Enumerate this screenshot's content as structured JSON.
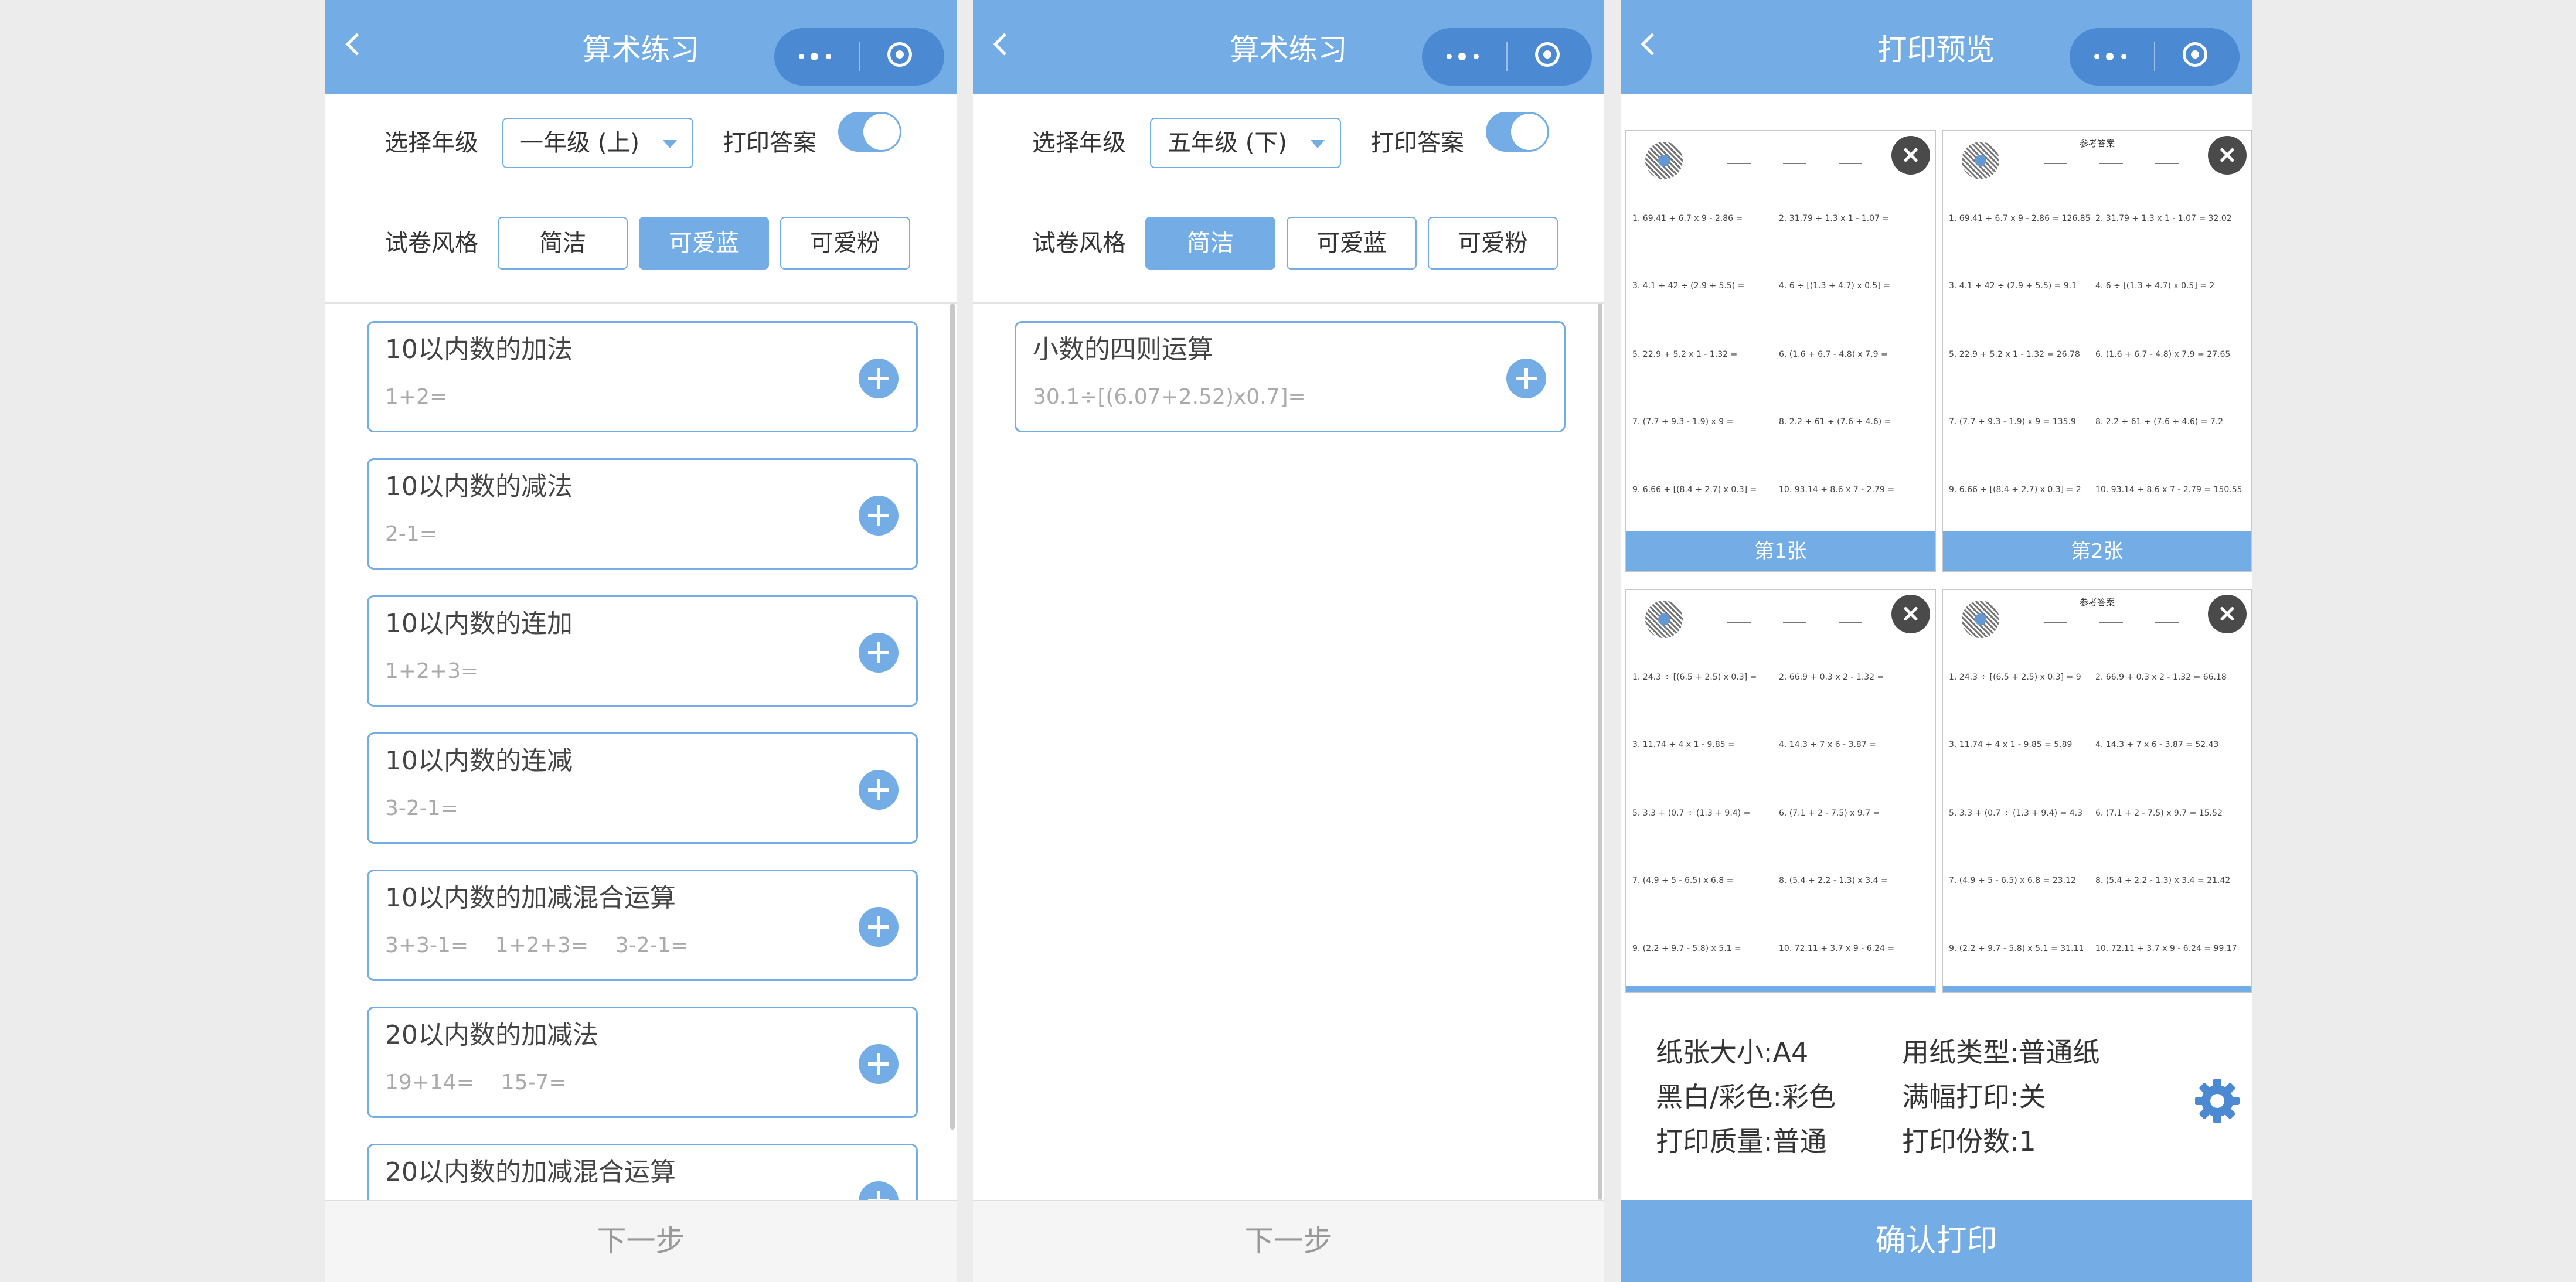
{
  "screen1": {
    "title": "算术练习",
    "grade_label": "选择年级",
    "grade_value": "一年级 (上)",
    "print_answer_label": "打印答案",
    "style_label": "试卷风格",
    "styles": [
      "简洁",
      "可爱蓝",
      "可爱粉"
    ],
    "active_style": "可爱蓝",
    "items": [
      {
        "title": "10以内数的加法",
        "example": "1+2="
      },
      {
        "title": "10以内数的减法",
        "example": "2-1="
      },
      {
        "title": "10以内数的连加",
        "example": "1+2+3="
      },
      {
        "title": "10以内数的连减",
        "example": "3-2-1="
      },
      {
        "title": "10以内数的加减混合运算",
        "example": "3+3-1=    1+2+3=    3-2-1="
      },
      {
        "title": "20以内数的加减法",
        "example": "19+14=    15-7="
      },
      {
        "title": "20以内数的加减混合运算",
        "example": ""
      }
    ],
    "next_label": "下一步"
  },
  "screen2": {
    "title": "算术练习",
    "grade_label": "选择年级",
    "grade_value": "五年级 (下)",
    "print_answer_label": "打印答案",
    "style_label": "试卷风格",
    "styles": [
      "简洁",
      "可爱蓝",
      "可爱粉"
    ],
    "active_style": "简洁",
    "items": [
      {
        "title": "小数的四则运算",
        "example": "30.1÷[(6.07+2.52)x0.7]="
      }
    ],
    "next_label": "下一步"
  },
  "screen3": {
    "title": "打印预览",
    "sheets": [
      {
        "label": "第1张",
        "answer_title": "",
        "questions": [
          "1.  69.41 + 6.7 x 9 - 2.86 =",
          "2.  31.79 + 1.3 x 1 - 1.07 =",
          "3.  4.1 + 42 ÷ (2.9 + 5.5) =",
          "4.  6 ÷ [(1.3 + 4.7) x 0.5] =",
          "5.  22.9 + 5.2 x 1 - 1.32 =",
          "6.  (1.6 + 6.7 - 4.8) x 7.9 =",
          "7.  (7.7 + 9.3 - 1.9) x 9 =",
          "8.  2.2 + 61 ÷ (7.6 + 4.6) =",
          "9.  6.66 ÷ [(8.4 + 2.7) x 0.3] =",
          "10. 93.14 + 8.6 x 7 - 2.79 ="
        ]
      },
      {
        "label": "第2张",
        "answer_title": "参考答案",
        "questions": [
          "1.  69.41 + 6.7 x 9 - 2.86 = 126.85",
          "2.  31.79 + 1.3 x 1 - 1.07 = 32.02",
          "3.  4.1 + 42 ÷ (2.9 + 5.5) = 9.1",
          "4.  6 ÷ [(1.3 + 4.7) x 0.5] = 2",
          "5.  22.9 + 5.2 x 1 - 1.32 = 26.78",
          "6.  (1.6 + 6.7 - 4.8) x 7.9 = 27.65",
          "7.  (7.7 + 9.3 - 1.9) x 9 = 135.9",
          "8.  2.2 + 61 ÷ (7.6 + 4.6) = 7.2",
          "9.  6.66 ÷ [(8.4 + 2.7) x 0.3] = 2",
          "10. 93.14 + 8.6 x 7 - 2.79 = 150.55"
        ]
      },
      {
        "label": "",
        "answer_title": "",
        "questions": [
          "1.  24.3 ÷ [(6.5 + 2.5) x 0.3] =",
          "2.  66.9 + 0.3 x 2 - 1.32 =",
          "3.  11.74 + 4 x 1 - 9.85 =",
          "4.  14.3 + 7 x 6 - 3.87 =",
          "5.  3.3 + (0.7 ÷ (1.3 + 9.4) =",
          "6.  (7.1 + 2 - 7.5) x 9.7 =",
          "7.  (4.9 + 5 - 6.5) x 6.8 =",
          "8.  (5.4 + 2.2 - 1.3) x 3.4 =",
          "9.  (2.2 + 9.7 - 5.8) x 5.1 =",
          "10. 72.11 + 3.7 x 9 - 6.24 ="
        ]
      },
      {
        "label": "",
        "answer_title": "参考答案",
        "questions": [
          "1.  24.3 ÷ [(6.5 + 2.5) x 0.3] = 9",
          "2.  66.9 + 0.3 x 2 - 1.32 = 66.18",
          "3.  11.74 + 4 x 1 - 9.85 = 5.89",
          "4.  14.3 + 7 x 6 - 3.87 = 52.43",
          "5.  3.3 + (0.7 ÷ (1.3 + 9.4) = 4.3",
          "6.  (7.1 + 2 - 7.5) x 9.7 = 15.52",
          "7.  (4.9 + 5 - 6.5) x 6.8 = 23.12",
          "8.  (5.4 + 2.2 - 1.3) x 3.4 = 21.42",
          "9.  (2.2 + 9.7 - 5.8) x 5.1 = 31.11",
          "10. 72.11 + 3.7 x 9 - 6.24 = 99.17"
        ]
      }
    ],
    "settings": {
      "paper_size": "纸张大小:A4",
      "paper_type": "用纸类型:普通纸",
      "color": "黑白/彩色:彩色",
      "full_bleed": "满幅打印:关",
      "quality": "打印质量:普通",
      "copies": "打印份数:1"
    },
    "confirm_label": "确认打印"
  },
  "colors": {
    "accent": "#74ade5",
    "capsule": "#4b8ad2"
  },
  "icons": [
    "back-icon",
    "more-icon",
    "target-icon",
    "plus-icon",
    "close-icon",
    "gear-icon",
    "qr-code-icon"
  ]
}
